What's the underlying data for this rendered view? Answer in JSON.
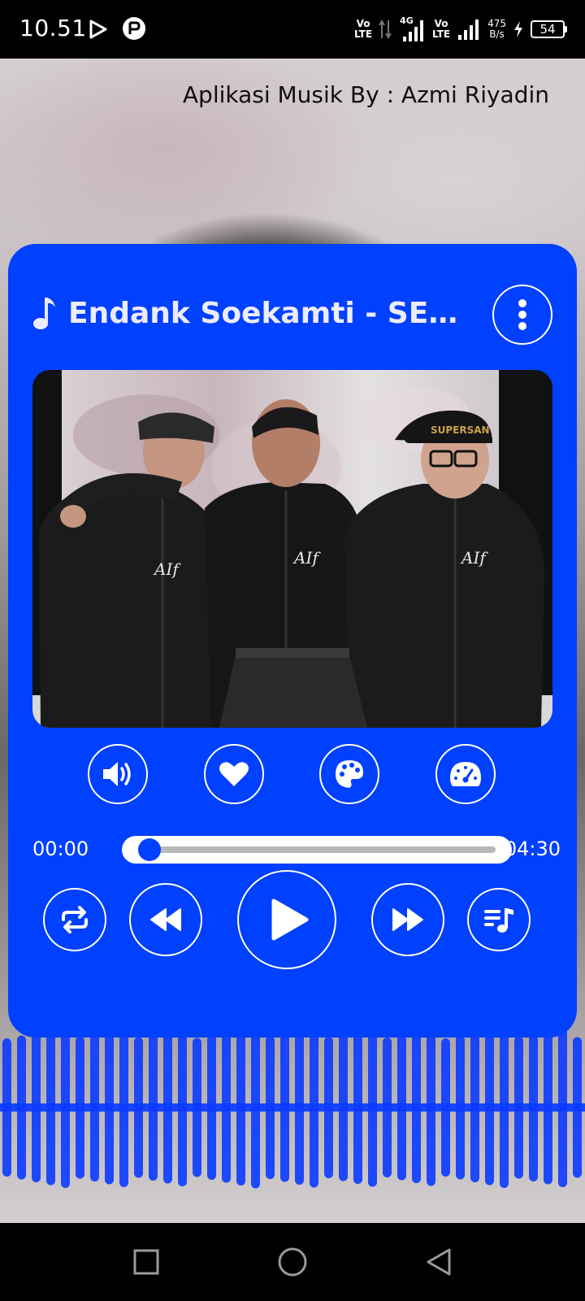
{
  "status_bar": {
    "time": "10.51",
    "network_1_top": "Vo",
    "network_1_bottom": "LTE",
    "network_2_label": "4G",
    "network_3_top": "Vo",
    "network_3_bottom": "LTE",
    "speed_value": "475",
    "speed_unit": "B/s",
    "battery": "54"
  },
  "header": {
    "app_title": "Aplikasi Musik By : Azmi Riyadin"
  },
  "player": {
    "song_title": "Endank Soekamti - SEMO...",
    "current_time": "00:00",
    "total_time": "04:30",
    "progress": 0.0,
    "actions": [
      "volume-icon",
      "heart-icon",
      "palette-icon",
      "speedometer-icon"
    ],
    "controls": [
      "repeat-icon",
      "rewind-icon",
      "play-icon",
      "fast-forward-icon",
      "playlist-icon"
    ]
  },
  "colors": {
    "accent": "#0040ff",
    "card": "#0040ff",
    "text_light": "#ffffff",
    "track": "#b9b9b9"
  },
  "nav_bar": {
    "icons": [
      "recent-apps-icon",
      "home-icon",
      "back-icon"
    ]
  }
}
